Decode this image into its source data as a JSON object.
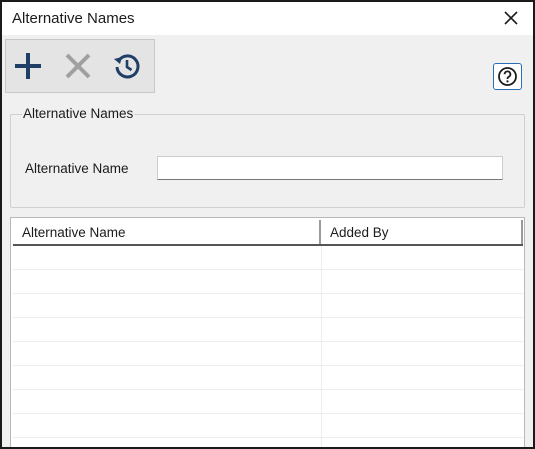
{
  "window": {
    "title": "Alternative Names"
  },
  "toolbar": {
    "buttons": [
      {
        "name": "add-button",
        "icon": "plus-icon",
        "color": "#1f3f66"
      },
      {
        "name": "delete-button",
        "icon": "x-icon",
        "color": "#a0a0a0"
      },
      {
        "name": "history-button",
        "icon": "history-icon",
        "color": "#1f3f66"
      }
    ]
  },
  "help": {
    "icon": "question-icon",
    "color": "#2a6db5"
  },
  "group": {
    "legend": "Alternative Names",
    "field_label": "Alternative Name",
    "field_value": ""
  },
  "table": {
    "columns": [
      "Alternative Name",
      "Added By"
    ],
    "rows": [
      [
        "",
        ""
      ],
      [
        "",
        ""
      ],
      [
        "",
        ""
      ],
      [
        "",
        ""
      ],
      [
        "",
        ""
      ],
      [
        "",
        ""
      ],
      [
        "",
        ""
      ],
      [
        "",
        ""
      ],
      [
        "",
        ""
      ]
    ]
  }
}
